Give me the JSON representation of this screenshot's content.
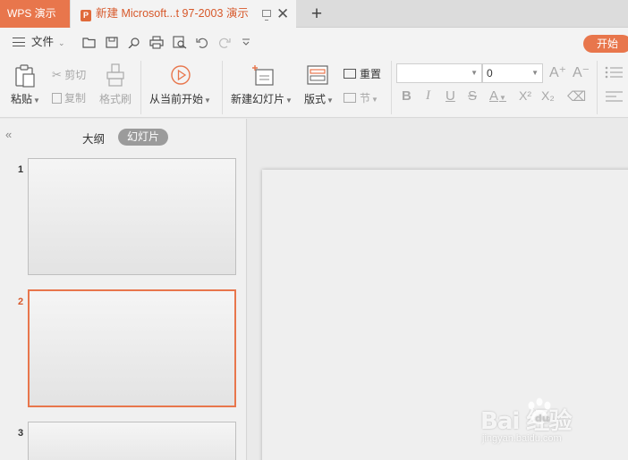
{
  "tabbar": {
    "app_label": "WPS 演示",
    "doc_icon_letter": "P",
    "doc_title": "新建 Microsoft...t 97-2003 演示",
    "close_glyph": "✕",
    "new_tab_glyph": "+"
  },
  "menubar": {
    "file_label": "文件",
    "start_label": "开始",
    "icons": [
      "open-folder-icon",
      "save-icon",
      "find-icon",
      "print-icon",
      "print-preview-icon",
      "undo-icon",
      "redo-icon",
      "more-icon"
    ]
  },
  "ribbon": {
    "paste": "粘贴",
    "cut": "剪切",
    "copy": "复制",
    "format_painter": "格式刷",
    "play_from_current": "从当前开始",
    "new_slide": "新建幻灯片",
    "layout": "版式",
    "reset": "重置",
    "section": "节",
    "font_name_value": "",
    "font_size_value": "0",
    "increase_font_glyph": "A⁺",
    "decrease_font_glyph": "A⁻",
    "bold_glyph": "B",
    "italic_glyph": "I",
    "underline_glyph": "U",
    "strike_glyph": "S",
    "font_color_glyph": "A",
    "superscript_glyph": "X²",
    "subscript_glyph": "X₂",
    "clear_glyph": "⌫"
  },
  "leftpanel": {
    "outline_tab": "大纲",
    "slides_tab": "幻灯片",
    "collapse_glyph": "«",
    "thumbnails": [
      {
        "number": "1",
        "active": false
      },
      {
        "number": "2",
        "active": true
      },
      {
        "number": "3",
        "active": false
      }
    ]
  },
  "watermark": {
    "text": "Bai  经验",
    "url": "jingyan.baidu.com"
  },
  "colors": {
    "accent": "#e8764c",
    "accent_text": "#d7582a",
    "tabbar_bg": "#dcdcdc",
    "ribbon_bg": "#f3f3f3"
  }
}
